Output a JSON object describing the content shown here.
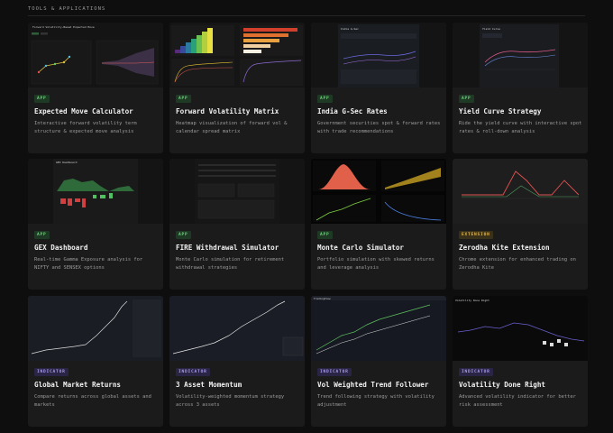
{
  "section_title": "TOOLS & APPLICATIONS",
  "cards": [
    {
      "badge": "APP",
      "title": "Expected Move Calculator",
      "desc": "Interactive forward volatility term structure & expected move analysis",
      "thumb_caption": "Forward Volatility-Based Expected Move"
    },
    {
      "badge": "APP",
      "title": "Forward Volatility Matrix",
      "desc": "Heatmap visualization of forward vol & calendar spread matrix"
    },
    {
      "badge": "APP",
      "title": "India G-Sec Rates",
      "desc": "Government securities spot & forward rates with trade recommendations",
      "thumb_caption": "India G-Sec"
    },
    {
      "badge": "APP",
      "title": "Yield Curve Strategy",
      "desc": "Ride the yield curve with interactive spot rates & roll-down analysis",
      "thumb_caption": "Yield Curve"
    },
    {
      "badge": "APP",
      "title": "GEX Dashboard",
      "desc": "Real-time Gamma Exposure analysis for NIFTY and SENSEX options",
      "thumb_caption": "GEX Dashboard"
    },
    {
      "badge": "APP",
      "title": "FIRE Withdrawal Simulator",
      "desc": "Monte Carlo simulation for retirement withdrawal strategies"
    },
    {
      "badge": "APP",
      "title": "Monte Carlo Simulator",
      "desc": "Portfolio simulation with skewed returns and leverage analysis"
    },
    {
      "badge": "EXTENSION",
      "title": "Zerodha Kite Extension",
      "desc": "Chrome extension for enhanced trading on Zerodha Kite"
    },
    {
      "badge": "INDICATOR",
      "title": "Global Market Returns",
      "desc": "Compare returns across global assets and markets"
    },
    {
      "badge": "INDICATOR",
      "title": "3 Asset Momentum",
      "desc": "Volatility-weighted momentum strategy across 3 assets"
    },
    {
      "badge": "INDICATOR",
      "title": "Vol Weighted Trend Follower",
      "desc": "Trend following strategy with volatility adjustment",
      "thumb_caption": "TradingView"
    },
    {
      "badge": "INDICATOR",
      "title": "Volatility Done Right",
      "desc": "Advanced volatility indicator for better risk assessment",
      "thumb_caption": "Volatility Done Right"
    }
  ],
  "colors": {
    "app_badge": "#6fd27e",
    "extension_badge": "#e8b84a",
    "indicator_badge": "#a89cf0"
  }
}
